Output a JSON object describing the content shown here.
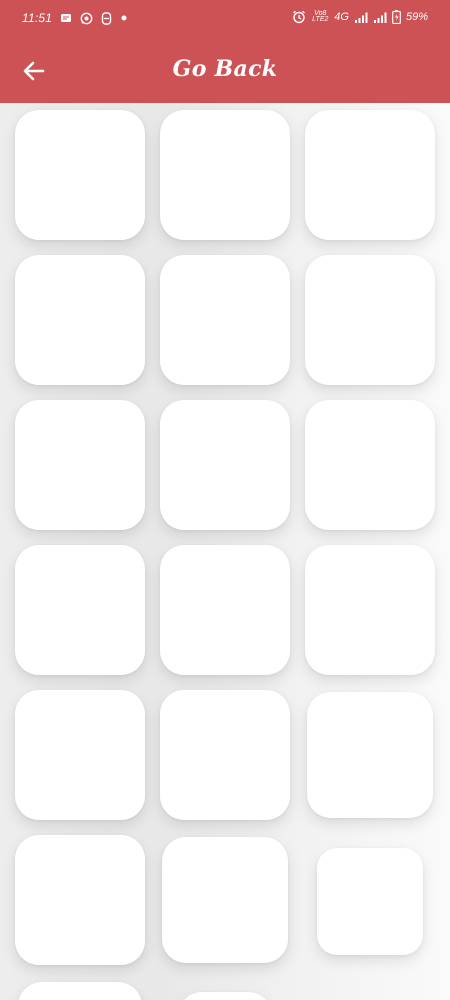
{
  "status_bar": {
    "time": "11:51",
    "network": "4G",
    "volte": "Vo8 LTE2",
    "battery": "59%",
    "left_icons": [
      "message-icon",
      "whatsapp-icon",
      "app-icon",
      "dot-icon"
    ],
    "right_icons": [
      "alarm-icon",
      "volte-icon",
      "signal-icon",
      "signal-icon",
      "battery-icon"
    ]
  },
  "app_bar": {
    "title": "Go Back",
    "back_icon": "arrow-left-icon",
    "color": "#cd5256"
  },
  "grid": {
    "tile_count": 20,
    "tile_color": "#ffffff"
  }
}
